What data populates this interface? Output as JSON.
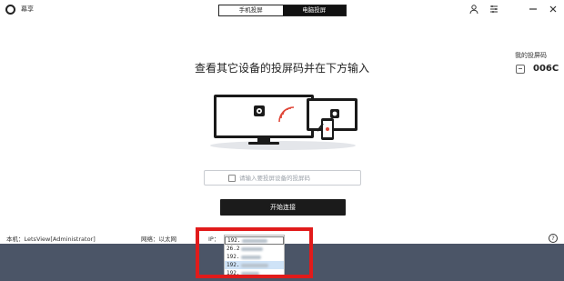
{
  "app": {
    "name": "幕享"
  },
  "mode_tabs": [
    {
      "label": "手机投屏",
      "active": false
    },
    {
      "label": "电脑投屏",
      "active": true
    }
  ],
  "window_controls": {
    "user_icon": "user-icon",
    "settings_icon": "settings-icon",
    "minimize_icon": "minimize-icon",
    "close_icon": "close-icon"
  },
  "main": {
    "headline": "查看其它设备的投屏码并在下方输入",
    "my_code_label": "我的投屏码",
    "my_code_value": "006C",
    "code_input_placeholder": "请输入要投屏设备的投屏码",
    "start_button": "开始连接"
  },
  "status": {
    "local": "本机：LetsView[Administrator]",
    "network": "网络：以太网",
    "ip_label": "IP："
  },
  "ip_dropdown": {
    "options": [
      "192.",
      "26.2",
      "192.",
      "192.",
      "192."
    ],
    "selected_index": 3
  },
  "colors": {
    "highlight": "#e11b1b",
    "accent": "#111111",
    "taskbar": "#4b5567"
  }
}
